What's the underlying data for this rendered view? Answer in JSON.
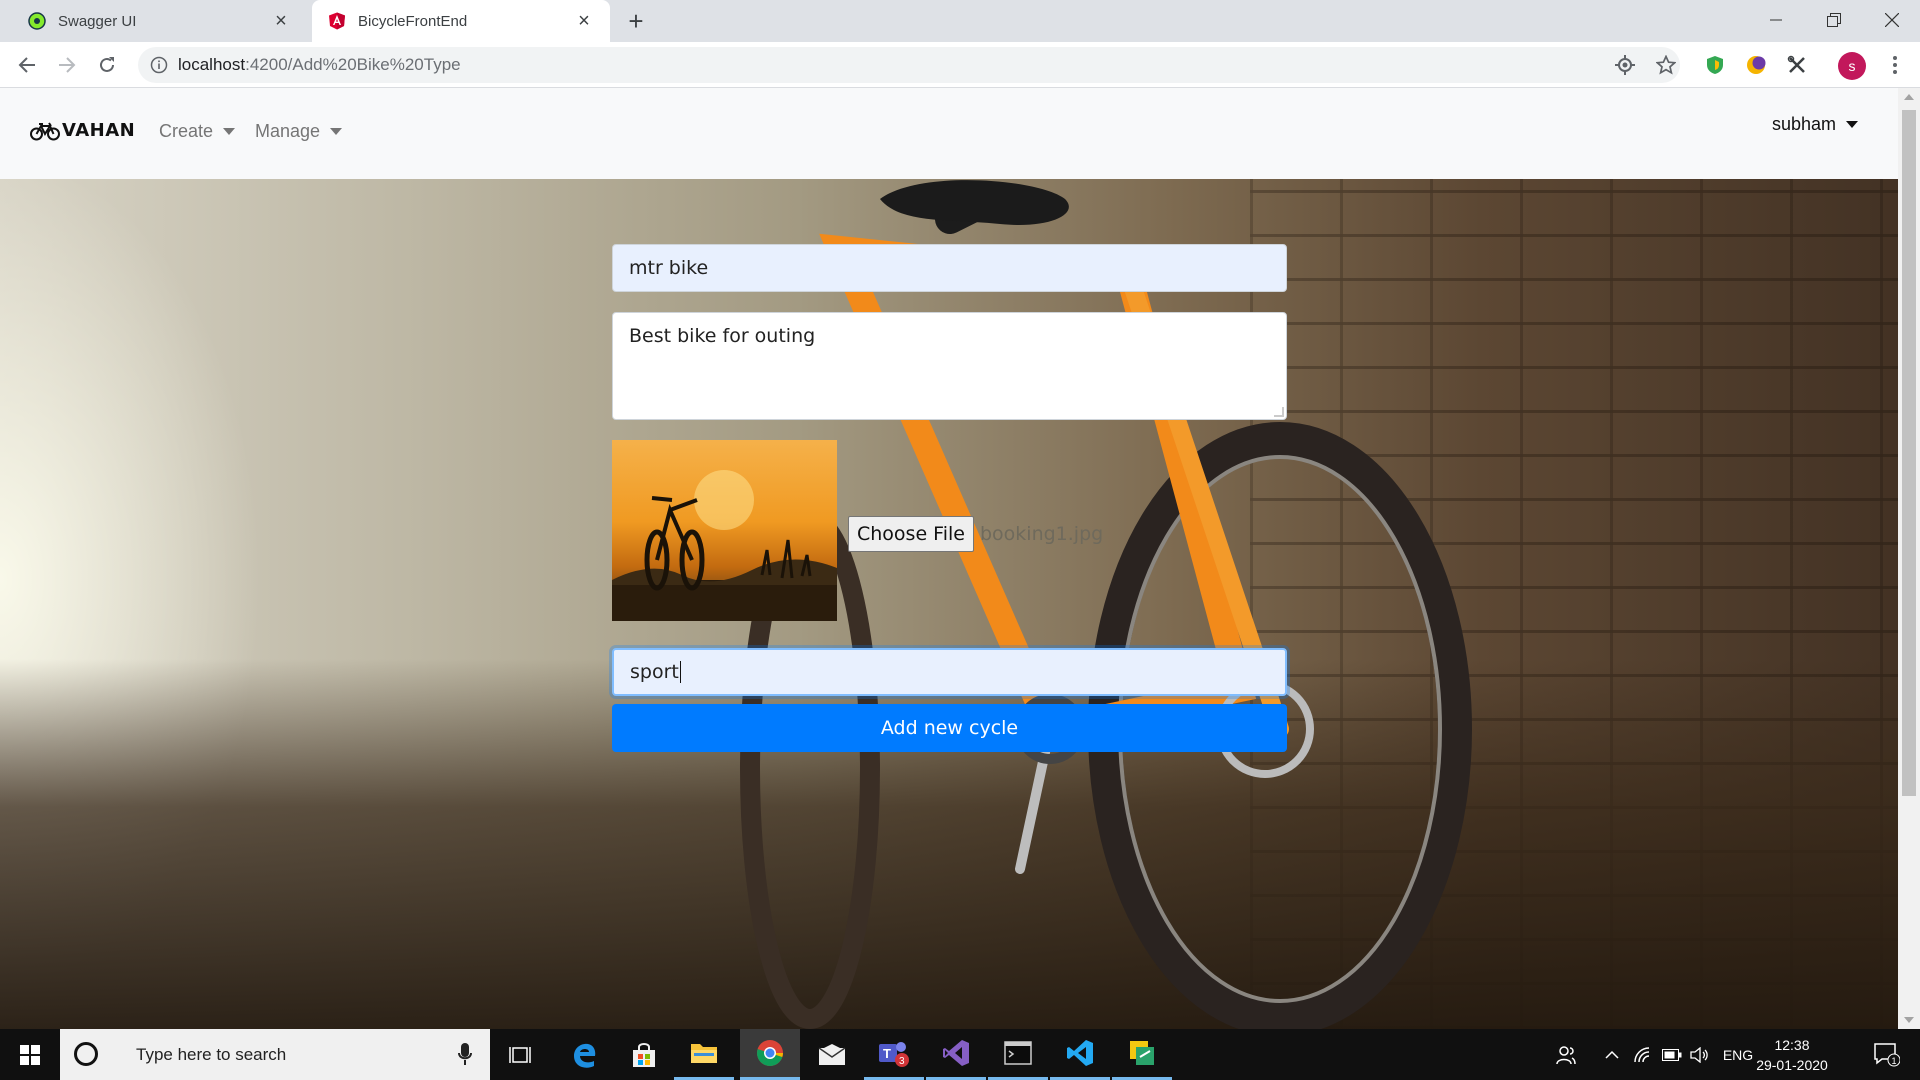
{
  "browser": {
    "tabs": [
      {
        "title": "Swagger UI",
        "icon": "swagger-favicon",
        "active": false
      },
      {
        "title": "BicycleFrontEnd",
        "icon": "angular-favicon",
        "active": true
      }
    ],
    "url_host": "localhost",
    "url_rest": ":4200/Add%20Bike%20Type",
    "profile_initial": "s"
  },
  "navbar": {
    "brand": "VAHAN",
    "brand_icon": "bicycle-icon",
    "links": [
      {
        "label": "Create"
      },
      {
        "label": "Manage"
      }
    ],
    "user": "subham"
  },
  "form": {
    "name_value": "mtr bike",
    "description_value": "Best bike for outing",
    "file_button": "Choose File",
    "file_name": "booking1.jpg",
    "type_value": "sport",
    "submit_label": "Add new cycle"
  },
  "taskbar": {
    "search_placeholder": "Type here to search",
    "language": "ENG",
    "time": "12:38",
    "date": "29-01-2020",
    "teams_badge": "3",
    "notification_count": "1"
  },
  "colors": {
    "primary": "#007bff",
    "navbar_bg": "#f8f9fa",
    "autofill_bg": "#e8f0fe",
    "profile": "#c2185b"
  }
}
